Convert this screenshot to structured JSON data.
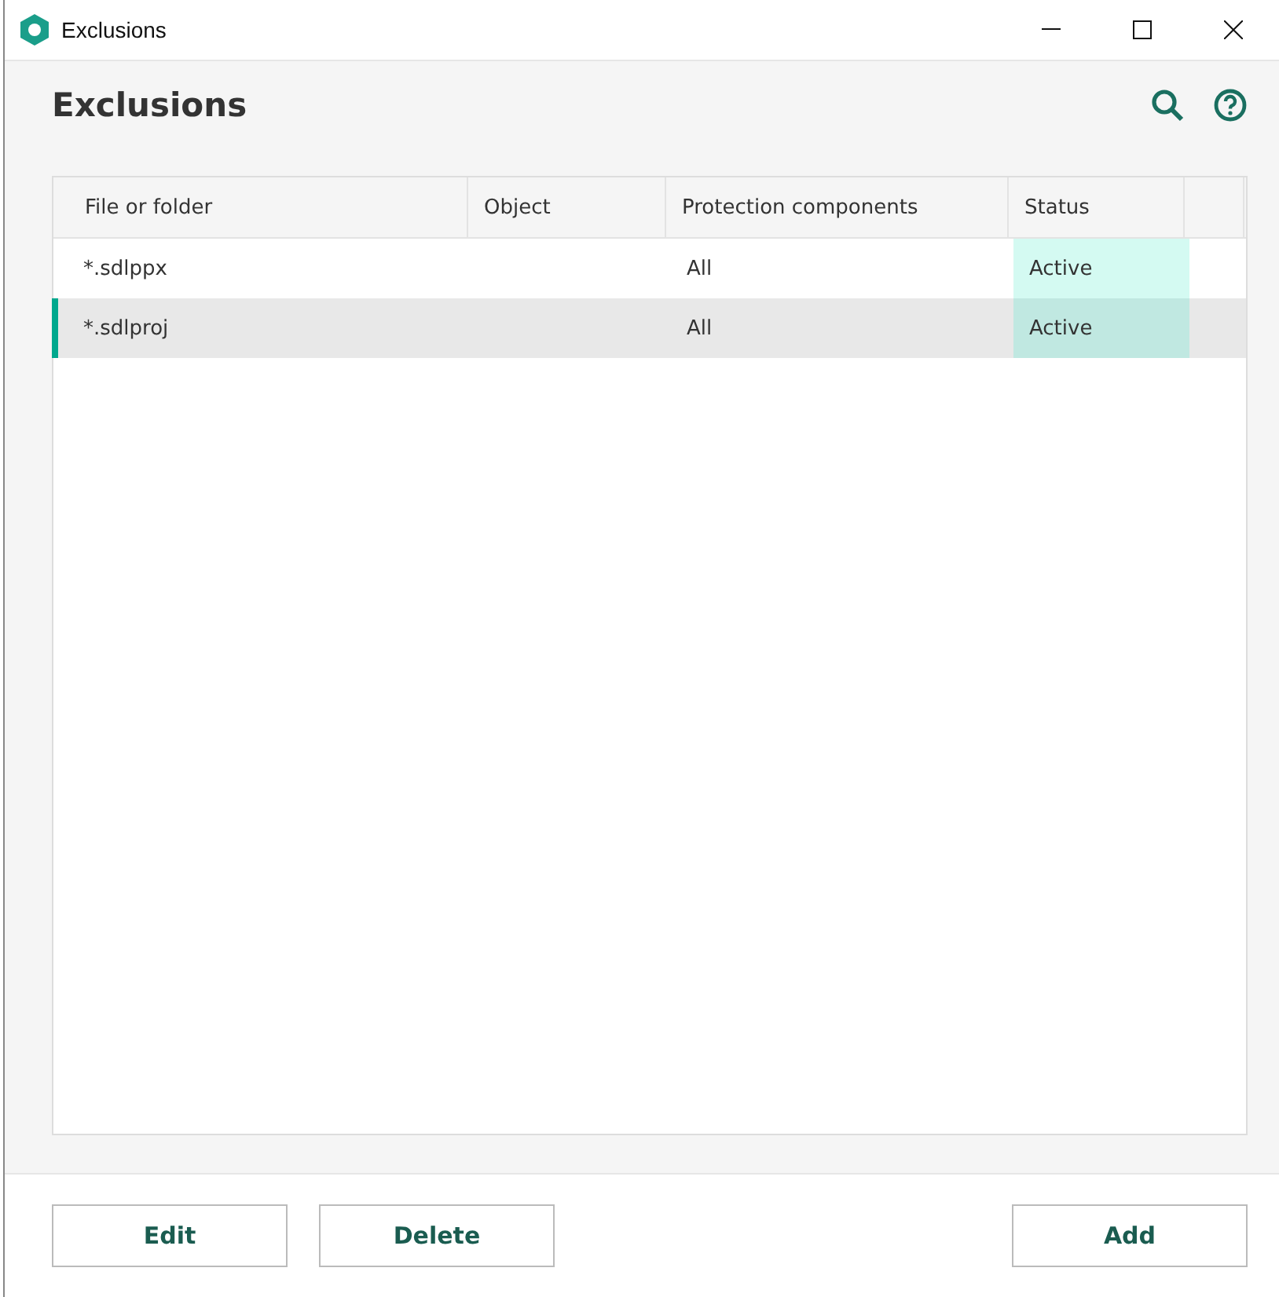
{
  "window": {
    "title": "Exclusions"
  },
  "page": {
    "heading": "Exclusions"
  },
  "table": {
    "columns": [
      "File or folder",
      "Object",
      "Protection components",
      "Status"
    ],
    "rows": [
      {
        "file_or_folder": "*.sdlppx",
        "protection_components": "All",
        "status": "Active",
        "selected": false
      },
      {
        "file_or_folder": "*.sdlproj",
        "protection_components": "All",
        "status": "Active",
        "selected": true
      }
    ]
  },
  "buttons": [
    {
      "label": "Edit",
      "kind": "left"
    },
    {
      "label": "Delete",
      "kind": "left"
    },
    {
      "label": "Add",
      "kind": "right"
    }
  ]
}
